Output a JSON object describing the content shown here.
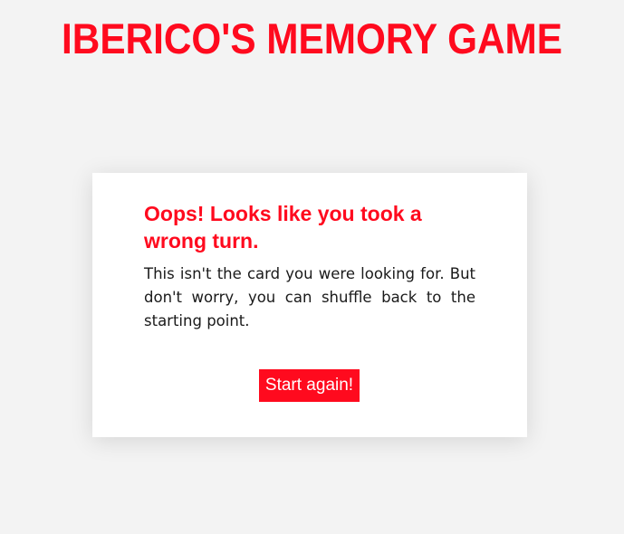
{
  "header": {
    "title": "IBERICO'S MEMORY GAME"
  },
  "card": {
    "heading": "Oops! Looks like you took a wrong turn.",
    "message": "This isn't the card you were looking for. But don't worry, you can shuffle back to the starting point.",
    "button_label": "Start again!"
  },
  "colors": {
    "accent": "#ff0a1e",
    "background": "#f3f3f3",
    "card": "#ffffff",
    "text": "#1a1a1a"
  }
}
